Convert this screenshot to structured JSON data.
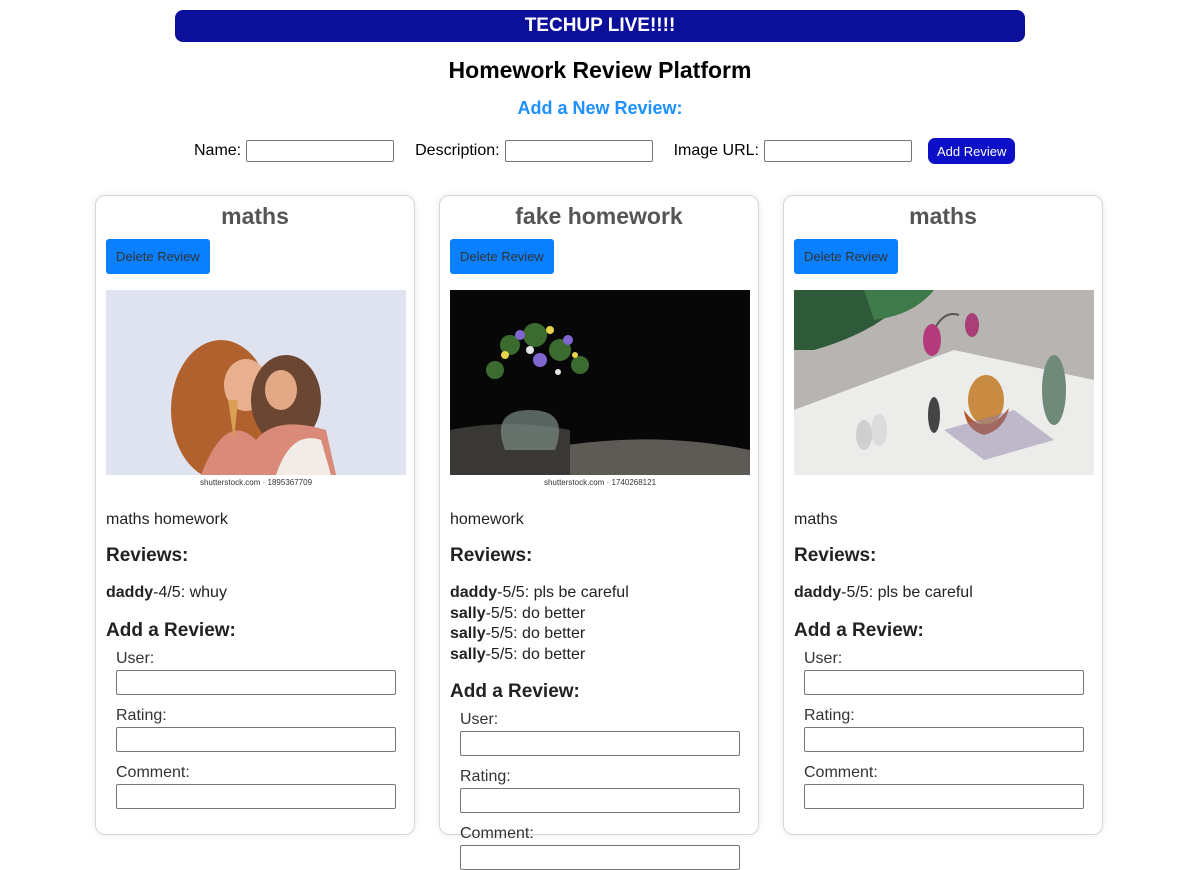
{
  "banner": "TECHUP LIVE!!!!",
  "page_title": "Homework Review Platform",
  "add_heading": "Add a New Review:",
  "new_form": {
    "name_label": "Name:",
    "description_label": "Description:",
    "image_label": "Image URL:",
    "name_value": "",
    "description_value": "",
    "image_value": "",
    "submit_label": "Add Review"
  },
  "colors": {
    "banner": "#0c0f9a",
    "accent_heading": "#1e90ff",
    "add_button": "#0c0fc8",
    "delete_button": "#0a80ff"
  },
  "cards": [
    {
      "title": "maths",
      "delete_label": "Delete Review",
      "image_watermark": "shutterstock.com · 1895367709",
      "description": "maths homework",
      "reviews_heading": "Reviews:",
      "reviews": [
        {
          "user": "daddy",
          "rest": "-4/5: whuy"
        }
      ],
      "add_review_heading": "Add a Review:",
      "user_label": "User:",
      "rating_label": "Rating:",
      "comment_label": "Comment:"
    },
    {
      "title": "fake homework",
      "delete_label": "Delete Review",
      "image_watermark": "shutterstock.com · 1740268121",
      "description": "homework",
      "reviews_heading": "Reviews:",
      "reviews": [
        {
          "user": "daddy",
          "rest": "-5/5: pls be careful"
        },
        {
          "user": "sally",
          "rest": "-5/5: do better"
        },
        {
          "user": "sally",
          "rest": "-5/5: do better"
        },
        {
          "user": "sally",
          "rest": "-5/5: do better"
        }
      ],
      "add_review_heading": "Add a Review:",
      "user_label": "User:",
      "rating_label": "Rating:",
      "comment_label": "Comment:"
    },
    {
      "title": "maths",
      "delete_label": "Delete Review",
      "image_watermark": "",
      "description": "maths",
      "reviews_heading": "Reviews:",
      "reviews": [
        {
          "user": "daddy",
          "rest": "-5/5: pls be careful"
        }
      ],
      "add_review_heading": "Add a Review:",
      "user_label": "User:",
      "rating_label": "Rating:",
      "comment_label": "Comment:"
    }
  ]
}
